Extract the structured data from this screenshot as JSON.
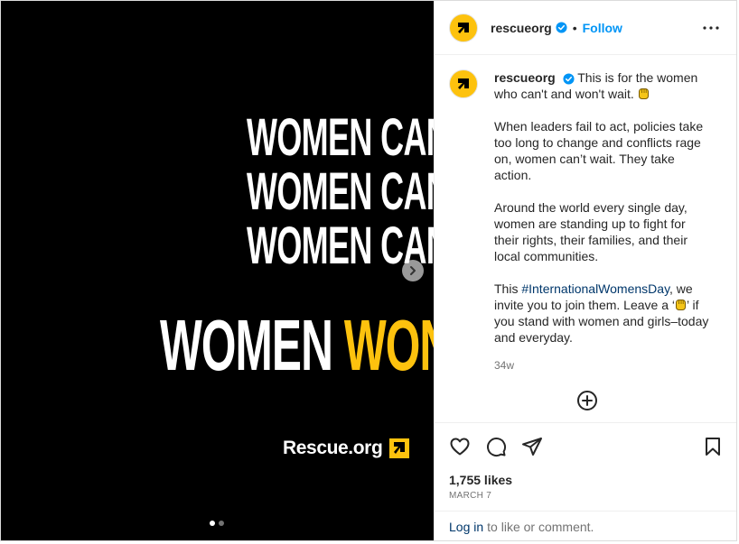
{
  "media": {
    "lines": [
      "WOMEN CAN’T",
      "WOMEN CAN’T",
      "WOMEN CAN’T"
    ],
    "big_white": "WOMEN",
    "big_yellow": "WON’T",
    "brand": "Rescue.org",
    "slide_count": 2,
    "active_slide": 1
  },
  "header": {
    "username": "rescueorg",
    "separator": "•",
    "follow": "Follow"
  },
  "caption": {
    "username": "rescueorg",
    "first_line": "This is for the women who can't and won't wait.",
    "p2": "When leaders fail to act, policies take too long to change and conflicts rage on, women can’t wait. They take action.",
    "p3": "Around the world every single day, women are standing up to fight for their rights,  their families, and their local communities.",
    "p4_pre": "This ",
    "p4_tag": "#InternationalWomensDay",
    "p4_mid": ", we invite you to join them. Leave a ‘",
    "p4_post": "’ if you stand with women and girls–today and everyday.",
    "time": "34w"
  },
  "footer": {
    "likes": "1,755 likes",
    "date": "MARCH 7",
    "login": "Log in",
    "login_rest": "to like or comment."
  },
  "colors": {
    "brand_yellow": "#fdc20e",
    "link_blue": "#0095f6",
    "hashtag_blue": "#00376b",
    "verified_blue": "#0095f6"
  },
  "icons": [
    "ircdog-logo-icon",
    "verified-badge-icon",
    "more-options-icon",
    "chevron-right-icon",
    "add-comment-icon",
    "heart-icon",
    "comment-icon",
    "share-icon",
    "bookmark-icon",
    "raised-fist-icon"
  ]
}
